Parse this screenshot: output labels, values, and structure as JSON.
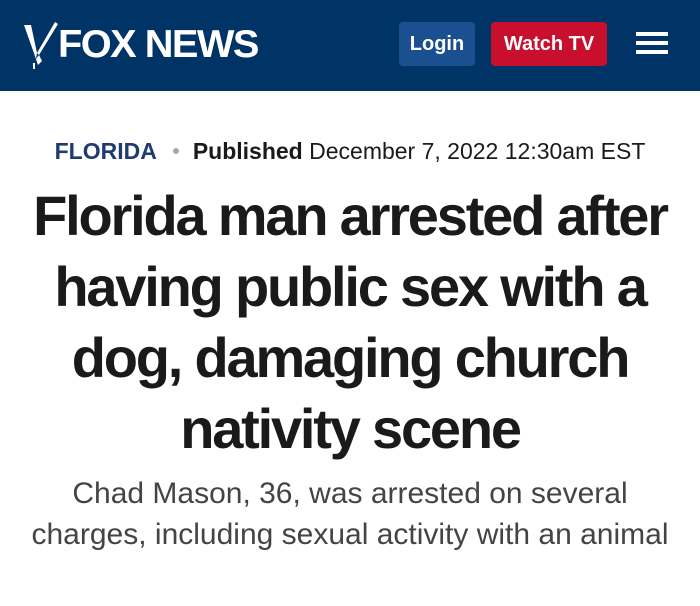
{
  "header": {
    "logo_text": "FOX NEWS",
    "login_label": "Login",
    "watch_tv_label": "Watch TV",
    "menu_icon": "hamburger-menu-icon",
    "colors": {
      "background": "#003366",
      "login": "#1a5090",
      "watch_tv": "#c8102e"
    }
  },
  "article": {
    "category": "FLORIDA",
    "published_label": "Published",
    "published_date": "December 7, 2022 12:30am EST",
    "headline": "Florida man arrested after having public sex with a dog, damaging church nativity scene",
    "subheadline": "Chad Mason, 36, was arrested on several charges, including sexual activity with an animal"
  }
}
